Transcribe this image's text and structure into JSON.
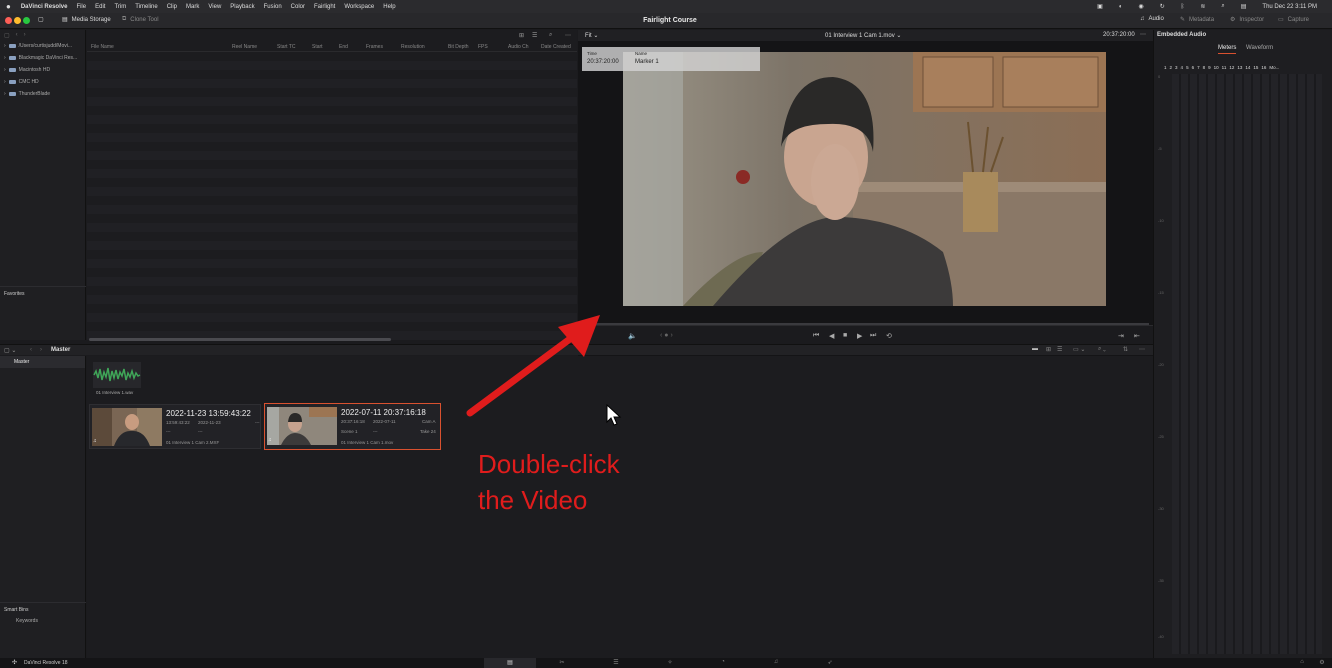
{
  "menubar": {
    "app_name": "DaVinci Resolve",
    "items": [
      "File",
      "Edit",
      "Trim",
      "Timeline",
      "Clip",
      "Mark",
      "View",
      "Playback",
      "Fusion",
      "Color",
      "Fairlight",
      "Workspace",
      "Help"
    ],
    "clock": "Thu Dec 22  3:11 PM"
  },
  "toolbar": {
    "media_storage": "Media Storage",
    "clone_tool": "Clone Tool",
    "project_title": "Fairlight Course",
    "audio": "Audio",
    "metadata": "Metadata",
    "inspector": "Inspector",
    "capture": "Capture"
  },
  "storage": {
    "locations": [
      "/Users/curtisjudd/Movi...",
      "Blackmagic DaVinci Res...",
      "Macintosh HD",
      "CMC HD",
      "ThunderBlade"
    ],
    "favorites_label": "Favorites",
    "columns": [
      "File Name",
      "Reel Name",
      "Start TC",
      "Start",
      "End",
      "Frames",
      "Resolution",
      "Bit Depth",
      "FPS",
      "Audio Ch",
      "Date Created"
    ]
  },
  "viewer": {
    "zoom": "Fit",
    "clip_name": "01 Interview 1 Cam 1.mov",
    "timecode": "20:37:20:00",
    "marker": {
      "time_label": "Time",
      "time": "20:37:20:00",
      "name_label": "Name",
      "name": "Marker 1"
    }
  },
  "right_panel": {
    "title": "Embedded Audio",
    "tabs": [
      "Meters",
      "Waveform"
    ],
    "channels": [
      "1",
      "2",
      "3",
      "4",
      "5",
      "6",
      "7",
      "8",
      "9",
      "10",
      "11",
      "12",
      "13",
      "14",
      "15",
      "16",
      "Mo..."
    ],
    "db_marks": [
      "0",
      "-5",
      "-10",
      "-15",
      "-20",
      "-25",
      "-30",
      "-35",
      "-40",
      "-45",
      "-50"
    ]
  },
  "bins": {
    "breadcrumb": "Master",
    "sidebar_master": "Master",
    "smart_bins": "Smart Bins",
    "keywords": "Keywords",
    "audio_clip_name": "01 Interview 1.wav",
    "clip1": {
      "title": "2022-11-23  13:59:43:22",
      "tc": "13:59:43:22",
      "date": "2022-11-23",
      "d1": "---",
      "d2": "---",
      "d3": "---",
      "name": "01 Interview 1 Cam 2.MXF"
    },
    "clip2": {
      "title": "2022-07-11  20:37:16:18",
      "tc": "20:37:16:18",
      "date": "2022-07-11",
      "cam": "Cam A",
      "scene": "Scene 1",
      "dash": "---",
      "take": "Take 24",
      "name": "01 Interview 1 Cam 1.mov"
    }
  },
  "annotation": {
    "line1": "Double-click",
    "line2": "the Video"
  },
  "footer": {
    "app_version": "DaVinci Resolve 18"
  },
  "colors": {
    "selection": "#d9512f",
    "annotation": "#e01c1c",
    "meter_tab_underline": "#d9512f"
  }
}
